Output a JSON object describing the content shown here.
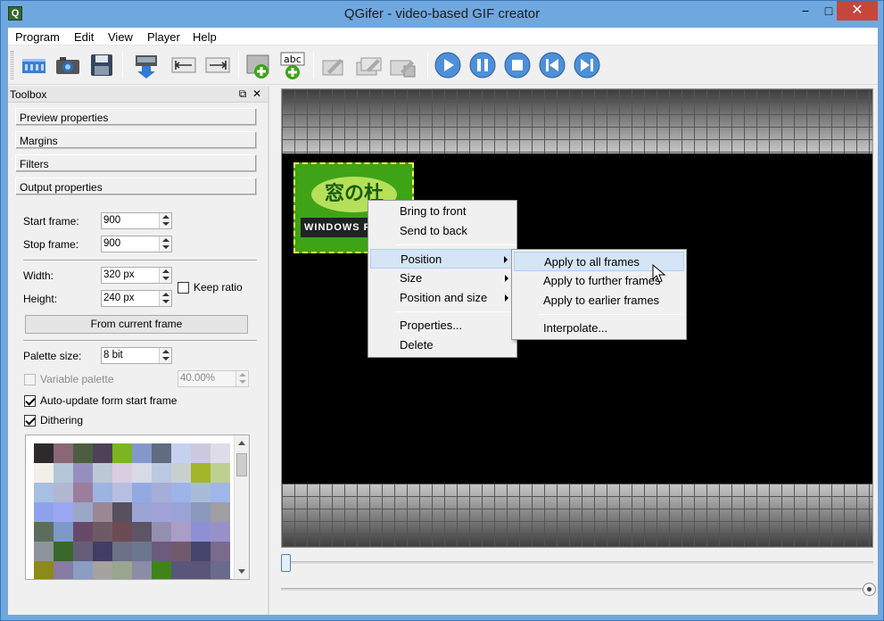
{
  "window": {
    "title": "QGifer - video-based GIF creator",
    "icon_letter": "Q",
    "minimize": "−",
    "maximize": "□",
    "close": "✕"
  },
  "menubar": [
    "Program",
    "Edit",
    "View",
    "Player",
    "Help"
  ],
  "toolbar_icons": [
    "open-video-icon",
    "open-camera-icon",
    "save-icon",
    "extract-gif-icon",
    "set-start-icon",
    "set-stop-icon",
    "add-image-object-icon",
    "add-text-object-icon",
    "edit-icon",
    "edit-multiple-icon",
    "remove-icon",
    "play-icon",
    "pause-icon",
    "stop-icon",
    "previous-icon",
    "next-icon"
  ],
  "toolbox": {
    "title": "Toolbox",
    "sections": [
      "Preview properties",
      "Margins",
      "Filters",
      "Output properties"
    ],
    "start_frame": {
      "label": "Start frame:",
      "value": "900"
    },
    "stop_frame": {
      "label": "Stop frame:",
      "value": "900"
    },
    "width": {
      "label": "Width:",
      "value": "320 px"
    },
    "height": {
      "label": "Height:",
      "value": "240 px"
    },
    "keep_ratio": {
      "label": "Keep ratio",
      "checked": false
    },
    "from_current_frame": "From current frame",
    "palette_size": {
      "label": "Palette size:",
      "value": "8 bit"
    },
    "variable_palette": {
      "label": "Variable palette",
      "value": "40.00%",
      "checked": false,
      "enabled": false
    },
    "auto_update": {
      "label": "Auto-update form start frame",
      "checked": true
    },
    "dithering": {
      "label": "Dithering",
      "checked": true
    },
    "palette_colors": [
      "#2d2a2d",
      "#8a6774",
      "#4d5d40",
      "#4f4157",
      "#7bb522",
      "#8598cc",
      "#616b82",
      "#c6d1ef",
      "#ccc9df",
      "#dedce6",
      "#f1efe7",
      "#b5c6d7",
      "#978ec0",
      "#bcc8d6",
      "#d9cde0",
      "#d8dae6",
      "#bac8e2",
      "#c9cfce",
      "#a3b528",
      "#bdd092",
      "#a7bfe2",
      "#b1b7d0",
      "#9b7d9c",
      "#9cb4e0",
      "#b6bfe1",
      "#93aae1",
      "#a5aed6",
      "#9bb5e8",
      "#a8bcd8",
      "#a2b5ea",
      "#8ea2ec",
      "#9ba7f2",
      "#9ba7c7",
      "#9b8794",
      "#56505f",
      "#9aa3d2",
      "#a1a2d8",
      "#9aa3d6",
      "#8c98bd",
      "#9e9ea3",
      "#5d6d5d",
      "#7c99c9",
      "#674a69",
      "#6e5a66",
      "#6d4b55",
      "#5d5566",
      "#948faf",
      "#aa9dc8",
      "#8e90d6",
      "#9692c9",
      "#8e949c",
      "#38692a",
      "#655e78",
      "#413d64",
      "#6c7188",
      "#6b778e",
      "#6c5b7d",
      "#725a6d",
      "#47466c",
      "#7a6a8e",
      "#8c8a1a",
      "#877ca2",
      "#8c9dc4",
      "#a5a2a0",
      "#9aa58f",
      "#8c8ca8",
      "#3f8419",
      "#58577a",
      "#5b5577",
      "#6a6a8c"
    ]
  },
  "preview": {
    "overlay_text_main": "窓の杜",
    "overlay_text_strip": "WINDOWS FOREST"
  },
  "context_menu": {
    "items": [
      "Bring to front",
      "Send to back",
      "Position",
      "Size",
      "Position and size",
      "Properties...",
      "Delete"
    ]
  },
  "submenu": {
    "items": [
      "Apply to all frames",
      "Apply to further frames",
      "Apply to earlier frames",
      "Interpolate..."
    ]
  },
  "playback_position": 0.0,
  "zoom_slider_position": 1.0
}
